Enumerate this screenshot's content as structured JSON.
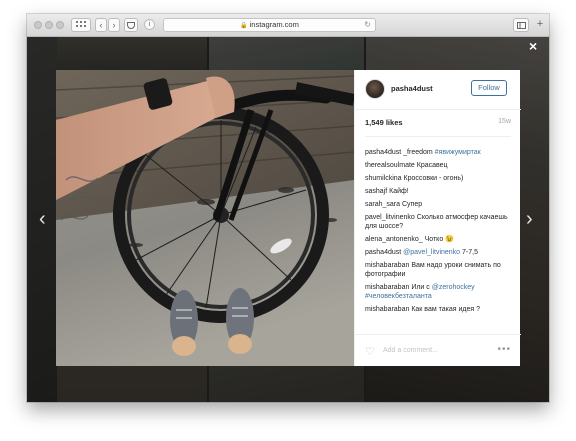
{
  "browser": {
    "url": "instagram.com",
    "lock_icon": "lock-icon",
    "reload_icon": "reload-icon"
  },
  "nav": {
    "prev_arrow": "‹",
    "next_arrow": "›",
    "close": "×"
  },
  "post": {
    "username": "pasha4dust",
    "follow_label": "Follow",
    "likes": "1,549 likes",
    "time": "15w",
    "comments": [
      {
        "user": "pasha4dust",
        "text": " _freedom ",
        "mention": "#явижумиртак"
      },
      {
        "user": "therealsoulmate",
        "text": " Красавец",
        "mention": ""
      },
      {
        "user": "shumilckina",
        "text": " Кроссовки - огонь)",
        "mention": ""
      },
      {
        "user": "sashajf",
        "text": " Кайф!",
        "mention": ""
      },
      {
        "user": "sarah_sara",
        "text": " Супер",
        "mention": ""
      },
      {
        "user": "pavel_litvinenko",
        "text": " Сколько атмосфер качаешь для шоссе?",
        "mention": ""
      },
      {
        "user": "alena_antonenko_",
        "text": " Чотко 😉",
        "mention": ""
      },
      {
        "user": "pasha4dust",
        "text": " ",
        "mention": "@pavel_litvinenko",
        "tail": " 7-7,5"
      },
      {
        "user": "mishabaraban",
        "text": " Вам надо уроки снимать по фотографии",
        "mention": ""
      },
      {
        "user": "mishabaraban",
        "text": " Или с ",
        "mention": "@zerohockey #человекбезталанта"
      },
      {
        "user": "mishabaraban",
        "text": " Как вам такая идея ?",
        "mention": ""
      }
    ],
    "add_comment_placeholder": "Add a comment...",
    "more_label": "•••"
  }
}
